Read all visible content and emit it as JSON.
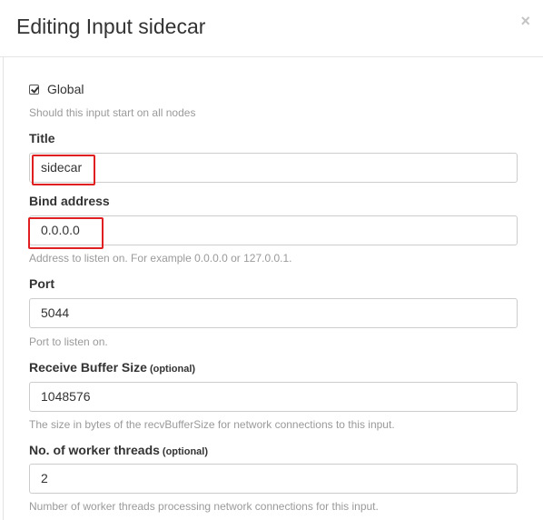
{
  "dialog": {
    "title": "Editing Input sidecar",
    "close_glyph": "×"
  },
  "global": {
    "label": "Global",
    "checked": true,
    "help": "Should this input start on all nodes"
  },
  "title_field": {
    "label": "Title",
    "value": "sidecar"
  },
  "bind_address": {
    "label": "Bind address",
    "value": "0.0.0.0",
    "help": "Address to listen on. For example 0.0.0.0 or 127.0.0.1."
  },
  "port": {
    "label": "Port",
    "value": "5044",
    "help": "Port to listen on."
  },
  "recv_buffer": {
    "label": "Receive Buffer Size",
    "optional": "(optional)",
    "value": "1048576",
    "help": "The size in bytes of the recvBufferSize for network connections to this input."
  },
  "worker_threads": {
    "label": "No. of worker threads",
    "optional": "(optional)",
    "value": "2",
    "help": "Number of worker threads processing network connections for this input."
  },
  "colors": {
    "highlight": "#e02020",
    "help_text": "#9a9a9a",
    "border": "#cccccc"
  }
}
